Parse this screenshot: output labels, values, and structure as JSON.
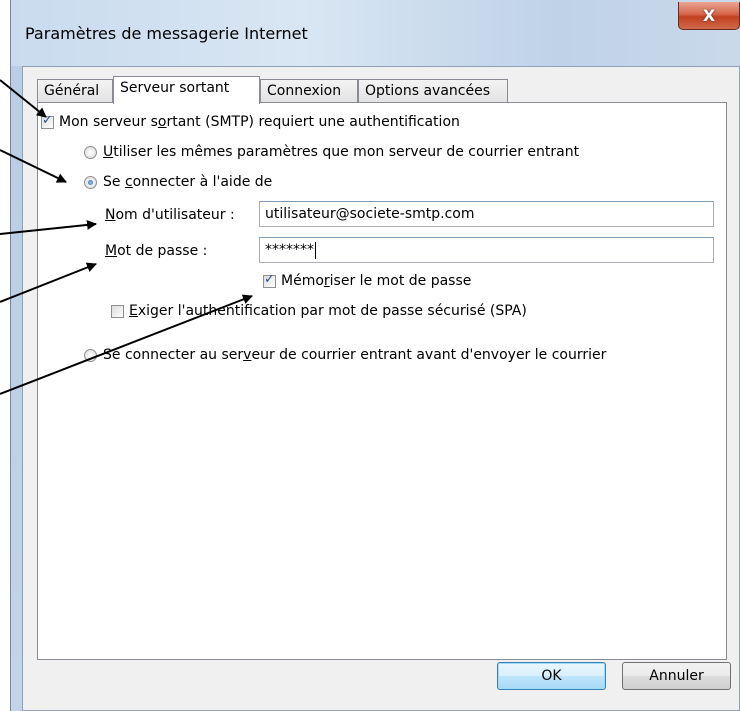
{
  "window": {
    "title": "Paramètres de messagerie Internet",
    "close_label": "X"
  },
  "tabs": [
    {
      "label": "Général"
    },
    {
      "label": "Serveur sortant",
      "active": true
    },
    {
      "label": "Connexion"
    },
    {
      "label": "Options avancées"
    }
  ],
  "auth": {
    "requires_auth_label_pre": "Mon serveur s",
    "requires_auth_label_u": "o",
    "requires_auth_label_post": "rtant (SMTP) requiert une authentification",
    "requires_auth_checked": true,
    "same_settings_u": "U",
    "same_settings_label": "tiliser les mêmes paramètres que mon serveur de courrier entrant",
    "same_settings_selected": false,
    "connect_with_pre": "Se ",
    "connect_with_u": "c",
    "connect_with_post": "onnecter à l'aide de",
    "connect_with_selected": true,
    "username_u": "N",
    "username_label": "om d'utilisateur :",
    "username_value": "utilisateur@societe-smtp.com",
    "password_u": "M",
    "password_label": "ot de passe :",
    "password_value": "*******",
    "remember_pre": "Mémo",
    "remember_u": "r",
    "remember_post": "iser le mot de passe",
    "remember_checked": true,
    "spa_u": "E",
    "spa_label": "xiger l'authentification par mot de passe sécurisé (SPA)",
    "spa_checked": false,
    "incoming_first_pre": "Se connecter au ser",
    "incoming_first_u": "v",
    "incoming_first_post": "eur de courrier entrant avant d'envoyer le courrier",
    "incoming_first_selected": false
  },
  "buttons": {
    "ok": "OK",
    "cancel": "Annuler"
  },
  "colors": {
    "arrow": "#000000",
    "titlebar": "#c9dbee",
    "close": "#c1401f"
  }
}
